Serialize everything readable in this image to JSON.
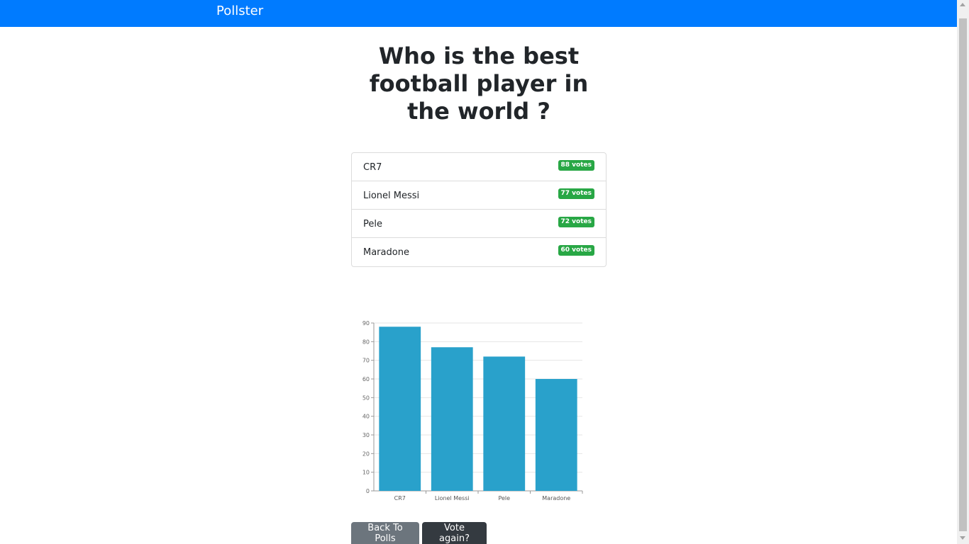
{
  "navbar": {
    "brand": "Pollster",
    "color": "#007bff"
  },
  "poll": {
    "question": "Who is the best football player in the world ?",
    "options": [
      {
        "label": "CR7",
        "votes": "88 votes"
      },
      {
        "label": "Lionel Messi",
        "votes": "77 votes"
      },
      {
        "label": "Pele",
        "votes": "72 votes"
      },
      {
        "label": "Maradone",
        "votes": "60 votes"
      }
    ]
  },
  "chart_data": {
    "type": "bar",
    "categories": [
      "CR7",
      "Lionel Messi",
      "Pele",
      "Maradone"
    ],
    "values": [
      88,
      77,
      72,
      60
    ],
    "ylim": [
      0,
      90
    ],
    "yticks": [
      "0",
      "10",
      "20",
      "30",
      "40",
      "50",
      "60",
      "70",
      "80",
      "90"
    ],
    "grid": true,
    "bar_color": "#29a1cb"
  },
  "buttons": {
    "back": "Back To Polls",
    "vote_again": "Vote again?"
  }
}
